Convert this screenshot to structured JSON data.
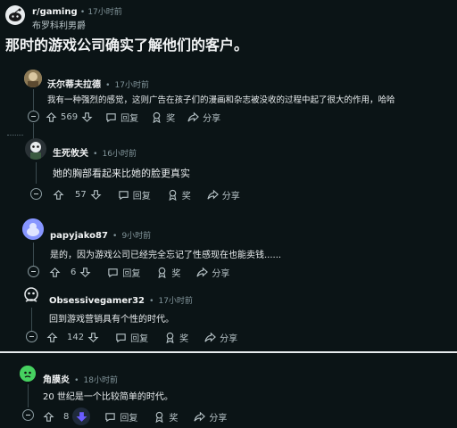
{
  "post": {
    "subreddit": "r/gaming",
    "time": "17小时前",
    "author": "布罗科利男爵",
    "title": "那时的游戏公司确实了解他们的客户。"
  },
  "actions": {
    "reply": "回复",
    "award": "奖",
    "share": "分享",
    "separator": "•"
  },
  "comments": [
    {
      "author": "沃尔蒂夫拉德",
      "time": "17小时前",
      "text": "我有一种强烈的感觉，这则广告在孩子们的漫画和杂志被没收的过程中起了很大的作用，哈哈",
      "votes": "569"
    },
    {
      "author": "生死攸关",
      "time": "16小时前",
      "text": "她的胸部看起来比她的脸更真实",
      "votes": "57"
    },
    {
      "author": "papyjako87",
      "time": "9小时前",
      "text": "是的，因为游戏公司已经完全忘记了性感现在也能卖钱......",
      "votes": "6"
    },
    {
      "author": "Obsessivegamer32",
      "time": "17小时前",
      "text": "回到游戏营销具有个性的时代。",
      "votes": "142"
    },
    {
      "author": "角膜炎",
      "time": "18小时前",
      "text": "20 世纪是一个比较简单的时代。",
      "votes": "8"
    }
  ],
  "colors": {
    "background": "#0b1416",
    "downvote_active": "#6a5cff"
  }
}
